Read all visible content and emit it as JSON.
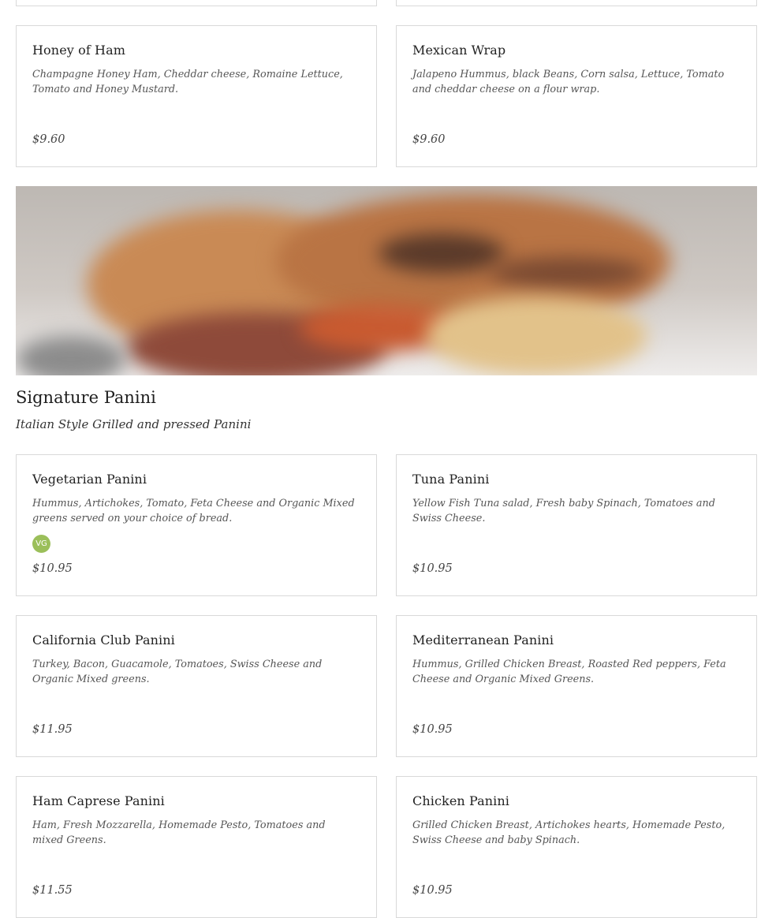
{
  "wraps": [
    {
      "title": "Honey of Ham",
      "description": "Champagne Honey Ham, Cheddar cheese, Romaine Lettuce, Tomato and Honey Mustard.",
      "price": "$9.60"
    },
    {
      "title": "Mexican Wrap",
      "description": "Jalapeno Hummus, black Beans, Corn salsa, Lettuce, Tomato and cheddar cheese on a flour wrap.",
      "price": "$9.60"
    }
  ],
  "panini_section": {
    "title": "Signature Panini",
    "subtitle": "Italian Style Grilled and pressed Panini",
    "items": [
      {
        "title": "Vegetarian Panini",
        "description": "Hummus, Artichokes, Tomato, Feta Cheese and Organic Mixed greens served on your choice of bread.",
        "badge": "VG",
        "price": "$10.95"
      },
      {
        "title": "Tuna Panini",
        "description": "Yellow Fish Tuna salad, Fresh baby Spinach, Tomatoes and Swiss Cheese.",
        "price": "$10.95"
      },
      {
        "title": "California Club Panini",
        "description": "Turkey, Bacon, Guacamole, Tomatoes, Swiss Cheese and Organic Mixed greens.",
        "price": "$11.95"
      },
      {
        "title": "Mediterranean Panini",
        "description": "Hummus, Grilled Chicken Breast, Roasted Red peppers, Feta Cheese and Organic Mixed Greens.",
        "price": "$10.95"
      },
      {
        "title": "Ham Caprese Panini",
        "description": "Ham, Fresh Mozzarella, Homemade Pesto, Tomatoes and mixed Greens.",
        "price": "$11.55"
      },
      {
        "title": "Chicken Panini",
        "description": "Grilled Chicken Breast, Artichokes hearts, Homemade Pesto, Swiss Cheese and baby Spinach.",
        "price": "$10.95"
      }
    ]
  },
  "colors": {
    "card_border": "#d9d9d9",
    "vg_badge": "#9bbf5a"
  }
}
